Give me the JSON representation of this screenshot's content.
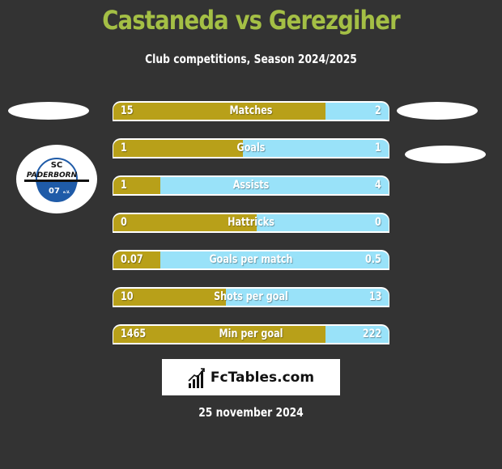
{
  "header": {
    "title": "Castaneda vs Gerezgiher",
    "subtitle": "Club competitions, Season 2024/2025"
  },
  "colors": {
    "background": "#333333",
    "title": "#a4bf45",
    "left_player": "#b8a019",
    "right_player": "#99e2f9"
  },
  "team_logo": {
    "icon": "sc-paderborn-crest-icon",
    "line1": "SC",
    "line2": "PADERBORN",
    "line3": "07",
    "suffix": "e.V."
  },
  "stats": [
    {
      "label": "Matches",
      "left": "15",
      "right": "2",
      "left_share": 0.77
    },
    {
      "label": "Goals",
      "left": "1",
      "right": "1",
      "left_share": 0.47
    },
    {
      "label": "Assists",
      "left": "1",
      "right": "4",
      "left_share": 0.17
    },
    {
      "label": "Hattricks",
      "left": "0",
      "right": "0",
      "left_share": 0.52
    },
    {
      "label": "Goals per match",
      "left": "0.07",
      "right": "0.5",
      "left_share": 0.17
    },
    {
      "label": "Shots per goal",
      "left": "10",
      "right": "13",
      "left_share": 0.41
    },
    {
      "label": "Min per goal",
      "left": "1465",
      "right": "222",
      "left_share": 0.77
    }
  ],
  "brand": {
    "icon": "bar-chart-trend-icon",
    "text": "FcTables.com"
  },
  "date": "25 november 2024"
}
